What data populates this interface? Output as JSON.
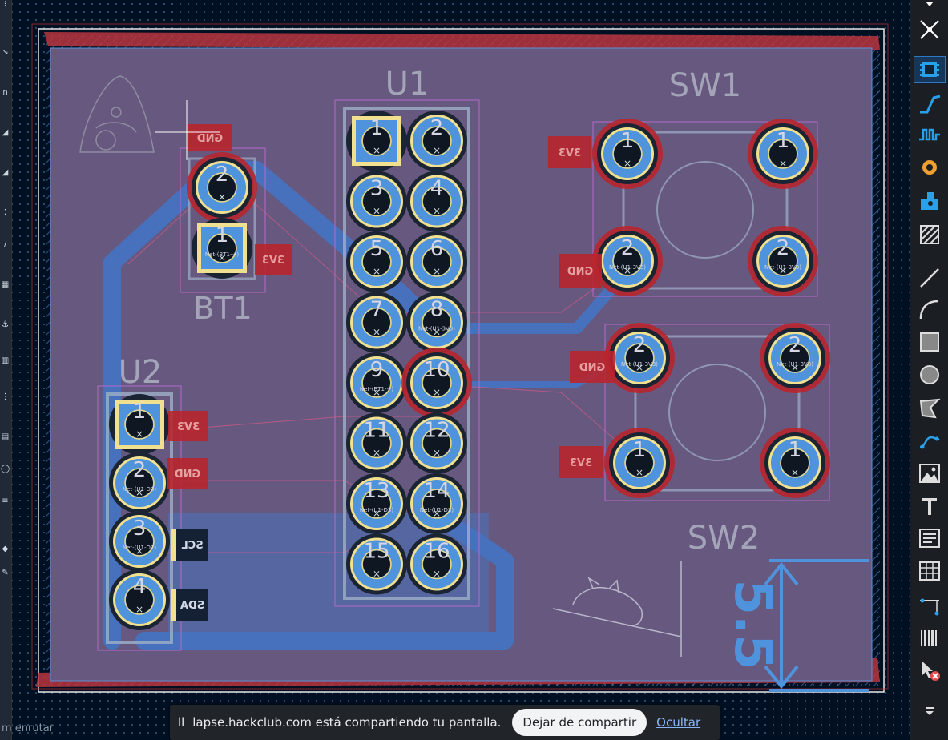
{
  "status_text": "m enrutar",
  "share_bar": {
    "pause_glyph": "II",
    "message": "lapse.hackclub.com está compartiendo tu pantalla.",
    "stop_label": "Dejar de compartir",
    "hide_label": "Ocultar"
  },
  "refs": {
    "u1": "U1",
    "u2": "U2",
    "bt1": "BT1",
    "sw1": "SW1",
    "sw2": "SW2"
  },
  "board_text": "5.5",
  "u1_pins": [
    "1",
    "2",
    "3",
    "4",
    "5",
    "6",
    "7",
    "8",
    "9",
    "10",
    "11",
    "12",
    "13",
    "14",
    "15",
    "16"
  ],
  "u1_nets": {
    "8": "Net-(U1-3V3)",
    "9": "Net-(BT1-+)",
    "13": "Net-(U1-D3)",
    "14": "Net-(U1-D3)"
  },
  "u2_pins": [
    "1",
    "2",
    "3",
    "4"
  ],
  "u2_nets": [
    "",
    "Net-(U1-D3)",
    "Net-(U1-D2)",
    ""
  ],
  "bt1_pins": [
    "2",
    "1"
  ],
  "bt1_net": "Net-(BT1-+)",
  "sw1_pins": [
    "1",
    "1",
    "2",
    "2"
  ],
  "sw1_net": "Net-(U1-3V3)",
  "sw2_pins": [
    "2",
    "2",
    "1",
    "1"
  ],
  "sw2_net": "Net-(U1-3V3)",
  "silk_labels": {
    "gnd": "GND",
    "v3": "3V3",
    "scl": "SCL",
    "sda": "SDA"
  },
  "colors": {
    "board": "#67587f",
    "copper": "#4574c4",
    "pad": "#4f93dc",
    "silk": "#d9d9d9",
    "mask": "#c13232",
    "zone_line": "#5a8fd6"
  },
  "right_toolbar": [
    "route-diff-pair-icon",
    "footprint-icon",
    "route-track-icon",
    "tune-length-icon",
    "via-icon",
    "add-footprint-icon",
    "fill-zone-icon",
    "line-icon",
    "arc-icon",
    "rectangle-icon",
    "circle-icon",
    "polygon-icon",
    "bezier-icon",
    "image-icon",
    "text-icon",
    "textbox-icon",
    "table-icon",
    "dimension-icon",
    "barcode-icon",
    "delete-tool-icon",
    "more-icon"
  ]
}
